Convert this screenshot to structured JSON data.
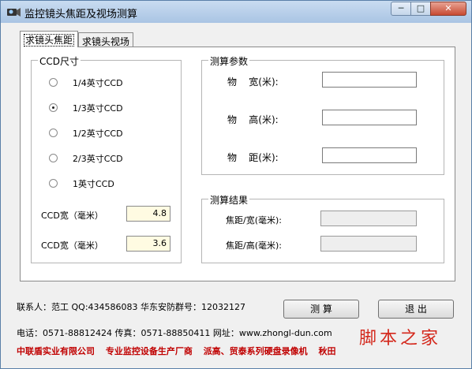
{
  "window": {
    "title": "监控镜头焦距及视场测算",
    "controls": {
      "minimize": "─",
      "maximize": "□",
      "close": "✕"
    }
  },
  "tabs": [
    {
      "label": "求镜头焦距",
      "active": true
    },
    {
      "label": "求镜头视场",
      "active": false
    }
  ],
  "ccd_group": {
    "legend": "CCD尺寸",
    "options": [
      {
        "label": "1/4英寸CCD",
        "checked": false
      },
      {
        "label": "1/3英寸CCD",
        "checked": true
      },
      {
        "label": "1/2英寸CCD",
        "checked": false
      },
      {
        "label": "2/3英寸CCD",
        "checked": false
      },
      {
        "label": "1英寸CCD",
        "checked": false
      }
    ],
    "width_label": "CCD宽（毫米）",
    "width_value": "4.8",
    "height_label": "CCD宽（毫米）",
    "height_value": "3.6"
  },
  "params_group": {
    "legend": "测算参数",
    "fields": [
      {
        "label": "物    宽(米):",
        "value": ""
      },
      {
        "label": "物    高(米):",
        "value": ""
      },
      {
        "label": "物    距(米):",
        "value": ""
      }
    ]
  },
  "results_group": {
    "legend": "测算结果",
    "fields": [
      {
        "label": "焦距/宽(毫米):",
        "value": ""
      },
      {
        "label": "焦距/高(毫米):",
        "value": ""
      }
    ]
  },
  "contact": {
    "line1": "联系人：范工    QQ:434586083 华东安防群号：12032127",
    "line2": "电话：0571-88812424  传真：0571-88850411   网址：www.zhongl-dun.com"
  },
  "buttons": {
    "calculate": "测  算",
    "exit": "退  出"
  },
  "footer": [
    "中联盾实业有限公司",
    "专业监控设备生产厂商",
    "派高、贸泰系列硬盘录像机",
    "秋田"
  ],
  "watermark": "脚本之家",
  "colors": {
    "footer": "#c00000",
    "readonly_bg": "#fffbe2",
    "titlebar": "#a9c4e3"
  }
}
